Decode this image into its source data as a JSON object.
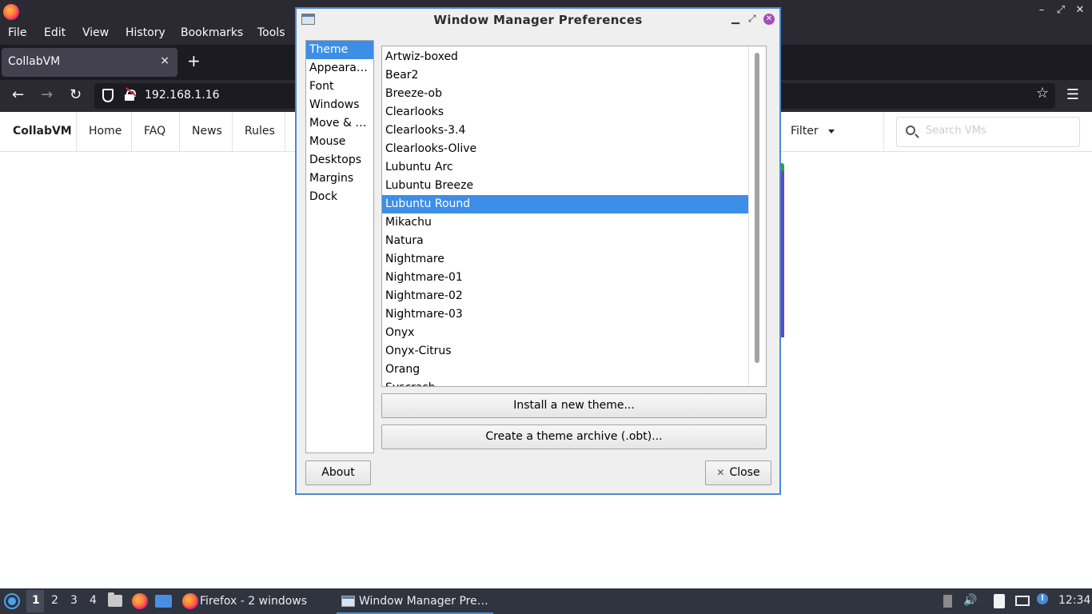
{
  "browser": {
    "menu": [
      "File",
      "Edit",
      "View",
      "History",
      "Bookmarks",
      "Tools"
    ],
    "tab_title": "CollabVM",
    "tab_close": "×",
    "new_tab": "+",
    "url": "192.168.1.16",
    "window_controls": {
      "minimize": "–",
      "restore": "⤢",
      "close": "✕"
    }
  },
  "site": {
    "brand": "CollabVM",
    "nav": [
      "Home",
      "FAQ",
      "News",
      "Rules"
    ],
    "filter_label": "Filter",
    "search_placeholder": "Search VMs"
  },
  "dialog": {
    "title": "Window Manager Preferences",
    "categories": [
      {
        "label": "Theme",
        "selected": true
      },
      {
        "label": "Appeara…",
        "selected": false
      },
      {
        "label": "Font",
        "selected": false
      },
      {
        "label": "Windows",
        "selected": false
      },
      {
        "label": "Move & …",
        "selected": false
      },
      {
        "label": "Mouse",
        "selected": false
      },
      {
        "label": "Desktops",
        "selected": false
      },
      {
        "label": "Margins",
        "selected": false
      },
      {
        "label": "Dock",
        "selected": false
      }
    ],
    "themes": [
      "Artwiz-boxed",
      "Bear2",
      "Breeze-ob",
      "Clearlooks",
      "Clearlooks-3.4",
      "Clearlooks-Olive",
      "Lubuntu Arc",
      "Lubuntu Breeze",
      "Lubuntu Round",
      "Mikachu",
      "Natura",
      "Nightmare",
      "Nightmare-01",
      "Nightmare-02",
      "Nightmare-03",
      "Onyx",
      "Onyx-Citrus",
      "Orang",
      "Syscrash"
    ],
    "selected_theme": "Lubuntu Round",
    "install_button": "Install a new theme...",
    "archive_button": "Create a theme archive (.obt)...",
    "about_button": "About",
    "close_button": "Close"
  },
  "taskbar": {
    "workspaces": [
      "1",
      "2",
      "3",
      "4"
    ],
    "active_workspace": "1",
    "tasks": [
      "Firefox - 2 windows",
      "Window Manager Pre…"
    ],
    "clock": "12:34"
  },
  "colors": {
    "accent": "#3d8ee6",
    "dialog_border": "#4a8ad5",
    "taskbar_bg": "#2f343f",
    "browser_chrome": "#2b2a33"
  }
}
